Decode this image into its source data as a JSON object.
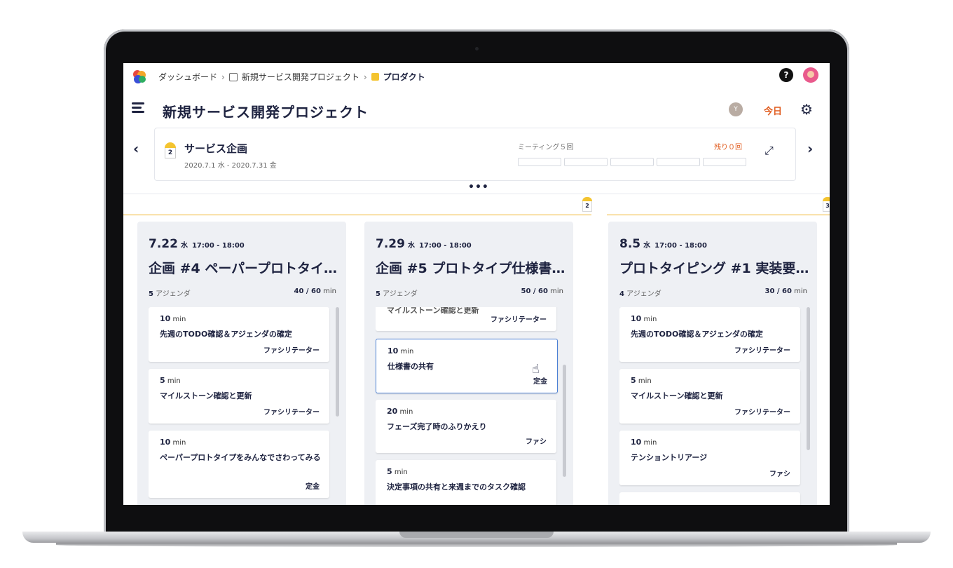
{
  "breadcrumb": {
    "dashboard": "ダッシュボード",
    "sep": "›",
    "project": "新規サービス開発プロジェクト",
    "product": "プロダクト"
  },
  "topbar": {
    "help": "?"
  },
  "header": {
    "project_title": "新規サービス開発プロジェクト",
    "member_initial": "Y",
    "today_label": "今日",
    "gear": "⚙"
  },
  "phase": {
    "prev": "‹",
    "next": "›",
    "number": "2",
    "name": "サービス企画",
    "dates": "2020.7.1 水 - 2020.7.31 金",
    "meetings_label": "ミーティング５回",
    "remaining_label": "残り０回",
    "expand": "⤢",
    "more": "•••"
  },
  "timeline": {
    "markers": [
      "2",
      "3"
    ]
  },
  "columns": [
    {
      "date": "7.22",
      "weekday": "水",
      "time": "17:00 - 18:00",
      "title": "企画 #4 ペーパープロトタイ…",
      "agenda_count": "5",
      "agenda_label": "アジェンダ",
      "used": "40",
      "total": "/ 60",
      "unit": "min",
      "items": [
        {
          "minutes": "10",
          "unit": "min",
          "title": "先週のTODO確認＆アジェンダの確定",
          "role": "ファシリテーター"
        },
        {
          "minutes": "5",
          "unit": "min",
          "title": "マイルストーン確認と更新",
          "role": "ファシリテーター"
        },
        {
          "minutes": "10",
          "unit": "min",
          "title": "ペーパープロトタイプをみんなでさわってみる",
          "role": "定金"
        }
      ]
    },
    {
      "date": "7.29",
      "weekday": "水",
      "time": "17:00 - 18:00",
      "title": "企画 #5 プロトタイプ仕様書…",
      "agenda_count": "5",
      "agenda_label": "アジェンダ",
      "used": "50",
      "total": "/ 60",
      "unit": "min",
      "items": [
        {
          "minutes": "",
          "unit": "",
          "title": "マイルストーン確認と更新",
          "role": "ファシリテーター"
        },
        {
          "minutes": "10",
          "unit": "min",
          "title": "仕様書の共有",
          "role": "定金"
        },
        {
          "minutes": "20",
          "unit": "min",
          "title": "フェーズ完了時のふりかえり",
          "role": "ファシ"
        },
        {
          "minutes": "5",
          "unit": "min",
          "title": "決定事項の共有と来週までのタスク確認",
          "role": ""
        }
      ]
    },
    {
      "date": "8.5",
      "weekday": "水",
      "time": "17:00 - 18:00",
      "title": "プロトタイピング #1 実装要…",
      "agenda_count": "4",
      "agenda_label": "アジェンダ",
      "used": "30",
      "total": "/ 60",
      "unit": "min",
      "items": [
        {
          "minutes": "10",
          "unit": "min",
          "title": "先週のTODO確認＆アジェンダの確定",
          "role": "ファシリテーター"
        },
        {
          "minutes": "5",
          "unit": "min",
          "title": "マイルストーン確認と更新",
          "role": "ファシリテーター"
        },
        {
          "minutes": "10",
          "unit": "min",
          "title": "テンショントリアージ",
          "role": "ファシ"
        }
      ]
    }
  ]
}
